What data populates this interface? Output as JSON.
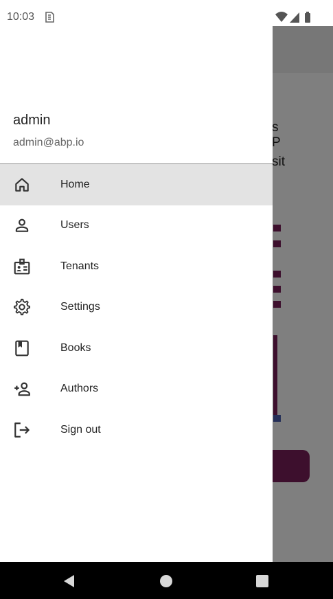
{
  "status_bar": {
    "time": "10:03",
    "icons": [
      "sim-card-icon",
      "wifi-icon",
      "signal-icon",
      "battery-icon"
    ]
  },
  "background_app": {
    "text_fragments": [
      "s",
      "P",
      "sit"
    ],
    "accent_color": "#7b1f5a"
  },
  "drawer": {
    "profile": {
      "name": "admin",
      "email": "admin@abp.io"
    },
    "menu_items": [
      {
        "label": "Home",
        "icon": "home-icon",
        "active": true
      },
      {
        "label": "Users",
        "icon": "person-icon",
        "active": false
      },
      {
        "label": "Tenants",
        "icon": "badge-icon",
        "active": false
      },
      {
        "label": "Settings",
        "icon": "gear-icon",
        "active": false
      },
      {
        "label": "Books",
        "icon": "book-icon",
        "active": false
      },
      {
        "label": "Authors",
        "icon": "person-add-icon",
        "active": false
      },
      {
        "label": "Sign out",
        "icon": "logout-icon",
        "active": false
      }
    ]
  },
  "nav_bar": {
    "buttons": [
      "back-icon",
      "home-circle-icon",
      "recents-icon"
    ]
  }
}
